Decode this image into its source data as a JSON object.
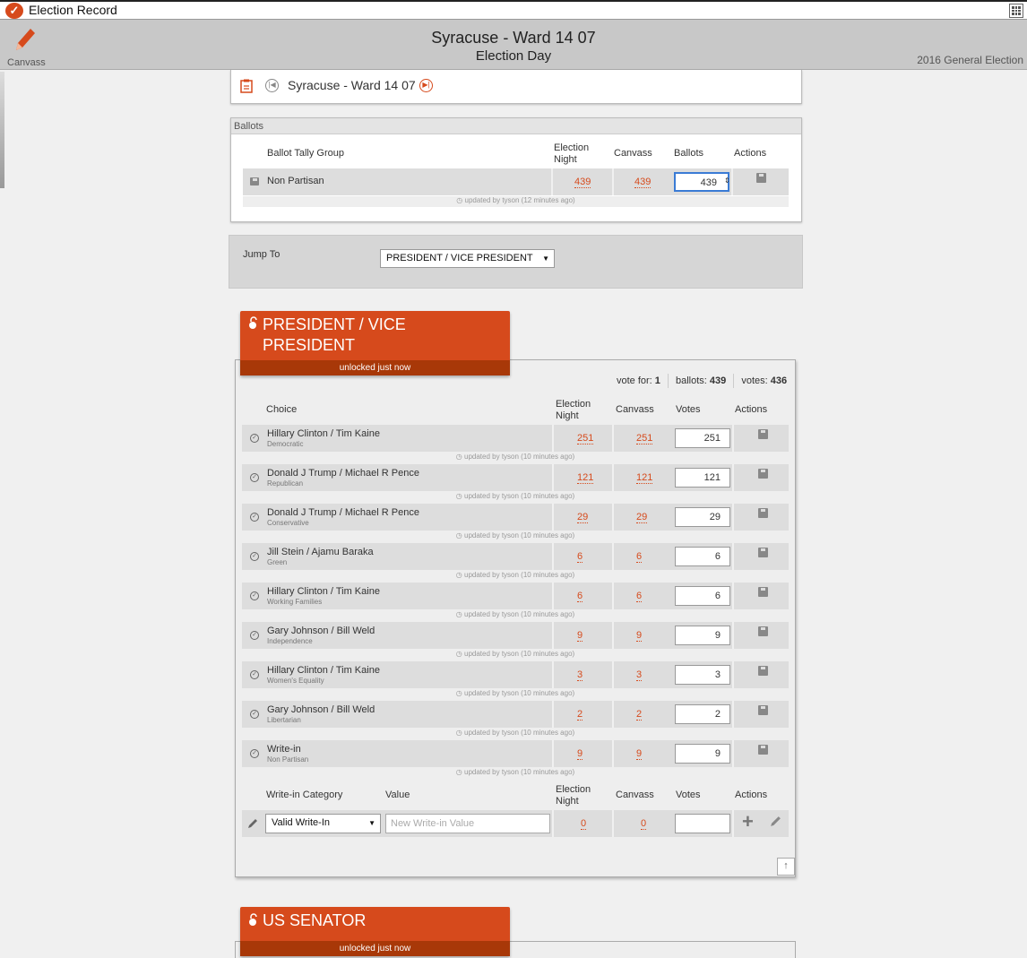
{
  "app": {
    "title": "Election Record"
  },
  "header": {
    "canvass_label": "Canvass",
    "title": "Syracuse - Ward 14 07",
    "subtitle": "Election Day",
    "election": "2016 General Election"
  },
  "nav": {
    "district": "Syracuse - Ward 14 07"
  },
  "ballots": {
    "section_label": "Ballots",
    "col_group": "Ballot Tally Group",
    "col_election_night": "Election Night",
    "col_canvass": "Canvass",
    "col_ballots": "Ballots",
    "col_actions": "Actions",
    "row": {
      "name": "Non Partisan",
      "election_night": "439",
      "canvass": "439",
      "ballots": "439"
    },
    "updated": "updated by tyson (12 minutes ago)"
  },
  "jump": {
    "label": "Jump To",
    "selected": "PRESIDENT / VICE PRESIDENT"
  },
  "race1": {
    "name_line1": "PRESIDENT / VICE",
    "name_line2": "PRESIDENT",
    "status": "unlocked just now",
    "vote_for_label": "vote for:",
    "vote_for": "1",
    "ballots_label": "ballots:",
    "ballots": "439",
    "votes_label": "votes:",
    "votes": "436",
    "col_choice": "Choice",
    "col_election_night": "Election Night",
    "col_canvass": "Canvass",
    "col_votes": "Votes",
    "col_actions": "Actions",
    "choices": [
      {
        "name": "Hillary Clinton / Tim Kaine",
        "party": "Democratic",
        "en": "251",
        "cv": "251",
        "votes": "251",
        "updated": "updated by tyson (10 minutes ago)"
      },
      {
        "name": "Donald J Trump / Michael R Pence",
        "party": "Republican",
        "en": "121",
        "cv": "121",
        "votes": "121",
        "updated": "updated by tyson (10 minutes ago)"
      },
      {
        "name": "Donald J Trump / Michael R Pence",
        "party": "Conservative",
        "en": "29",
        "cv": "29",
        "votes": "29",
        "updated": "updated by tyson (10 minutes ago)"
      },
      {
        "name": "Jill Stein / Ajamu Baraka",
        "party": "Green",
        "en": "6",
        "cv": "6",
        "votes": "6",
        "updated": "updated by tyson (10 minutes ago)"
      },
      {
        "name": "Hillary Clinton / Tim Kaine",
        "party": "Working Families",
        "en": "6",
        "cv": "6",
        "votes": "6",
        "updated": "updated by tyson (10 minutes ago)"
      },
      {
        "name": "Gary Johnson / Bill Weld",
        "party": "Independence",
        "en": "9",
        "cv": "9",
        "votes": "9",
        "updated": "updated by tyson (10 minutes ago)"
      },
      {
        "name": "Hillary Clinton / Tim Kaine",
        "party": "Women's Equality",
        "en": "3",
        "cv": "3",
        "votes": "3",
        "updated": "updated by tyson (10 minutes ago)"
      },
      {
        "name": "Gary Johnson / Bill Weld",
        "party": "Libertarian",
        "en": "2",
        "cv": "2",
        "votes": "2",
        "updated": "updated by tyson (10 minutes ago)"
      },
      {
        "name": "Write-in",
        "party": "Non Partisan",
        "en": "9",
        "cv": "9",
        "votes": "9",
        "updated": "updated by tyson (10 minutes ago)"
      }
    ],
    "writein": {
      "col_category": "Write-in Category",
      "col_value": "Value",
      "col_election_night": "Election Night",
      "col_canvass": "Canvass",
      "col_votes": "Votes",
      "col_actions": "Actions",
      "category_selected": "Valid Write-In",
      "value_placeholder": "New Write-in Value",
      "en": "0",
      "cv": "0"
    }
  },
  "race2": {
    "name": "US SENATOR",
    "status": "unlocked just now"
  },
  "icons": {
    "canvass": "pencil-icon",
    "logo": "check-badge-icon",
    "apps": "grid-icon",
    "save": "save-icon",
    "lock": "lock-open-icon",
    "check": "check-circle-icon",
    "add": "plus-icon",
    "edit": "pencil-icon",
    "up": "arrow-up-icon"
  },
  "colors": {
    "accent": "#d64a1c",
    "accent_dark": "#a83808"
  }
}
